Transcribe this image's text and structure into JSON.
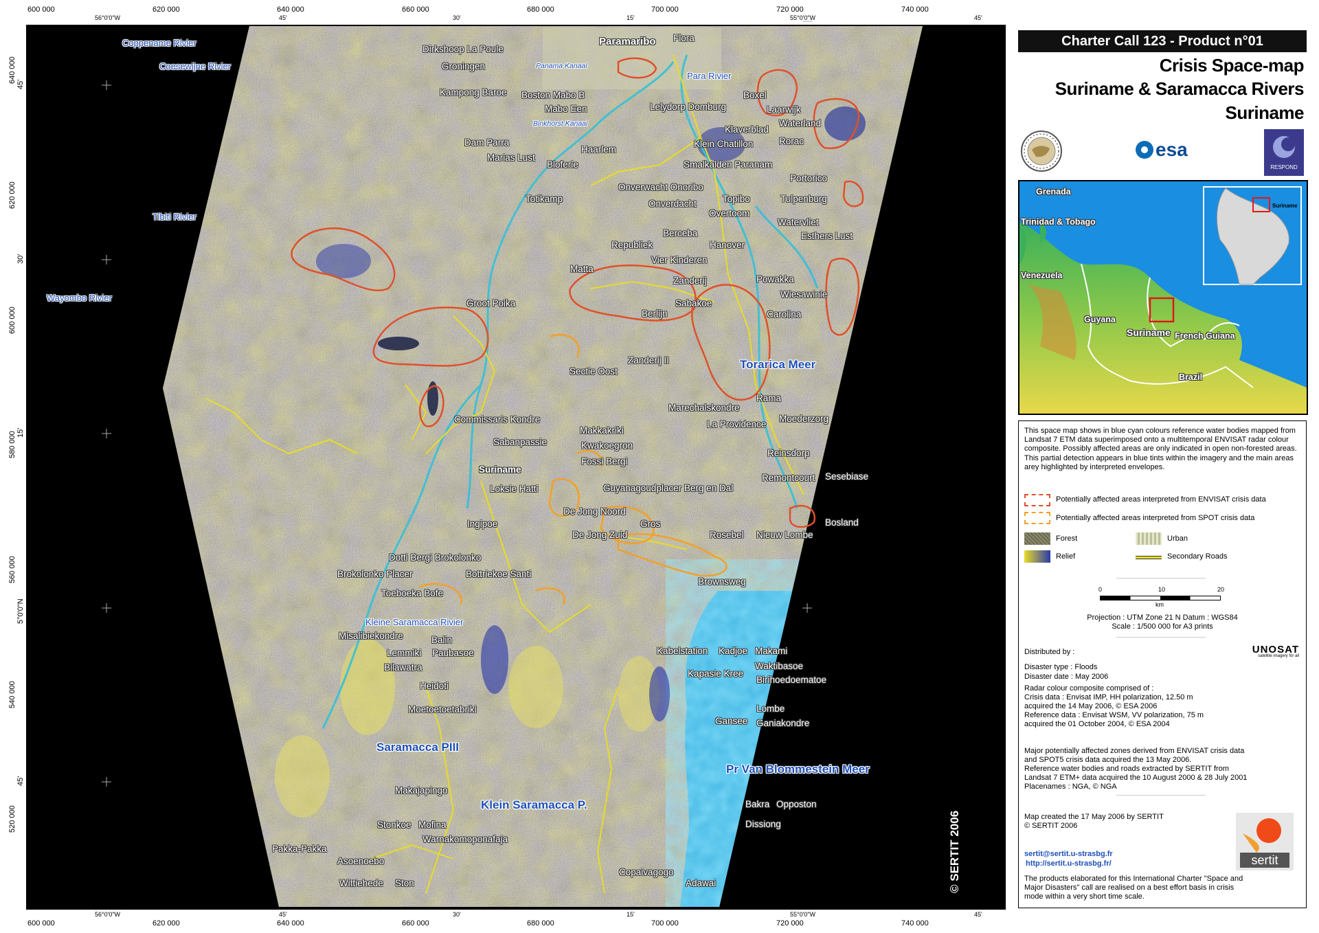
{
  "header": {
    "product_bar": "Charter Call 123 - Product n°01",
    "title_line1": "Crisis Space-map",
    "title_line2": "Suriname & Saramacca Rivers",
    "title_line3": "Suriname"
  },
  "logos": {
    "esa": "esa",
    "respond": "RESPOND",
    "unosat": "UNOSAT",
    "unosat_sub": "satellite imagery for all",
    "sertit": "sertit"
  },
  "grid": {
    "top_x_labels": [
      "600 000",
      "620 000",
      "640 000",
      "660 000",
      "680 000",
      "700 000",
      "720 000",
      "740 000"
    ],
    "bottom_x_labels": [
      "600 000",
      "620 000",
      "640 000",
      "660 000",
      "680 000",
      "700 000",
      "720 000",
      "740 000"
    ],
    "top_deg_labels": [
      "56°0'0\"W",
      "45'",
      "30'",
      "15'",
      "55°0'0\"W",
      "45'"
    ],
    "bottom_deg_labels": [
      "56°0'0\"W",
      "45'",
      "30'",
      "15'",
      "55°0'0\"W",
      "45'"
    ],
    "left_y_labels": [
      "640 000",
      "620 000",
      "600 000",
      "580 000",
      "560 000",
      "540 000",
      "520 000"
    ],
    "left_deg_labels": [
      "45'",
      "30'",
      "15'",
      "5°0'0\"N",
      "45'"
    ],
    "right_y_labels": [
      "640 000",
      "620 000",
      "600 000",
      "580 000",
      "560 000",
      "540 000",
      "520 000"
    ],
    "right_deg_labels": [
      "45'",
      "30'",
      "15'",
      "5°0'0\"N",
      "45'"
    ]
  },
  "rivers": [
    {
      "name": "Coppename Rivier"
    },
    {
      "name": "Coesewijne Rivier"
    },
    {
      "name": "Tibiti Rivier"
    },
    {
      "name": "Wayombo Rivier"
    },
    {
      "name": "Para Rivier"
    },
    {
      "name": "Panama Kanaal"
    },
    {
      "name": "Binkhorst Kanaal"
    },
    {
      "name": "Torarica Meer"
    },
    {
      "name": "Kleine Saramacca Rivier"
    },
    {
      "name": "Saramacca PIII"
    },
    {
      "name": "Klein Saramacca P."
    },
    {
      "name": "Pr Van Blommestein Meer"
    }
  ],
  "places": [
    "Paramaribo",
    "Flora",
    "Dirkshoop La Poule",
    "Groningen",
    "Kampong Baroe",
    "Boston Mabo B",
    "Mabo Een",
    "Lelydorp Domburg",
    "Boxel",
    "Laarwijk",
    "Waterland",
    "Dam Parra",
    "Marias Lust",
    "Haarlem",
    "Bloferie",
    "Klaverblad",
    "Klein Chatillon",
    "Rorac",
    "Smalkalden Paranam",
    "Portorico",
    "Onverwacht Onoribo",
    "Topibo",
    "Tulpenburg",
    "Totikamp",
    "Onverdacht",
    "Overtoom",
    "Watervliet",
    "Berceba",
    "Esthers Lust",
    "Republiek",
    "Hanover",
    "Vier Kinderen",
    "Matta",
    "Zanderij",
    "Powakka",
    "Groot Poika",
    "Sabakoe",
    "Wiesawinie",
    "Berlijn",
    "Carolina",
    "Zanderij II",
    "Sectie Oost",
    "Rama",
    "Marechalskondre",
    "Commissaris Kondre",
    "Moederzorg",
    "Makkakriki",
    "La Providence",
    "Kwakoegron",
    "Sabanpassie",
    "Fossi Bergi",
    "Reinsdorp",
    "Suriname",
    "Remontcourt",
    "Sesebiase",
    "Loksie Hatti",
    "Guyanagoudplacer Berg en Dal",
    "De Jong Noord",
    "Bosland",
    "Ingipoe",
    "Gros",
    "De Jong Zuid",
    "Rosebel",
    "Nieuw Lombe",
    "Dotti Bergi Brokolonko",
    "Brokolonko Placer",
    "Bottriekoe Santi",
    "Brownsweg",
    "Toeboeka Bofe",
    "Misalibiekondre",
    "Balin",
    "Lemmiki",
    "Paubasoe",
    "Kabelstation",
    "Kadjoe",
    "Makami",
    "Bilawatra",
    "Waktibasoe",
    "Kapasie Kree",
    "Birihoedoematoe",
    "Heidoti",
    "Moetoetoetabriki",
    "Lombe",
    "Gansee",
    "Ganiakondre",
    "Makajapingo",
    "Bakra",
    "Opposton",
    "Dissiong",
    "Stonkoe",
    "Mofina",
    "Warnakomoponafaja",
    "Pakka-Pakka",
    "Asoenoebo",
    "Copaivagogo",
    "Wittiehede",
    "Ston",
    "Adawai"
  ],
  "map_copyright": "© SERTIT 2006",
  "inset": {
    "labels": [
      "Grenada",
      "Trinidad & Tobago",
      "Venezuela",
      "Guyana",
      "Suriname",
      "French Guiana",
      "Brazil"
    ],
    "mini_label": "Suriname"
  },
  "panel": {
    "description": "This space map shows in blue cyan colours reference water bodies mapped from Landsat 7 ETM data superimposed onto a multitemporal ENVISAT radar colour composite. Possibly affected areas are only indicated in open non-forested areas. This partial detection appears in blue tints within the imagery and the main areas arey highlighted by interpreted envelopes.",
    "legend": {
      "envisat": "Potentially affected areas interpreted from ENVISAT crisis data",
      "spot": "Potentially affected areas interpreted from SPOT crisis data",
      "forest": "Forest",
      "urban": "Urban",
      "relief": "Relief",
      "roads": "Secondary Roads",
      "envisat_color": "#e0502a",
      "spot_color": "#f2a02a"
    },
    "scale": {
      "ticks": [
        "0",
        "10",
        "20"
      ],
      "unit": "km"
    },
    "projection": "Projection :  UTM Zone 21 N Datum : WGS84",
    "scale_text": "Scale : 1/500 000 for A3 prints",
    "distributed_by": "Distributed by :",
    "disaster_type": "Disaster type : Floods",
    "disaster_date": "Disaster date : May 2006",
    "radar_lines": [
      "Radar colour composite comprised of :",
      "Crisis data : Envisat IMP, HH polarization, 12.50 m",
      "acquired the 14 May 2006, © ESA 2006",
      "Reference data : Envisat WSM, VV polarization, 75 m",
      "acquired the 01 October 2004, © ESA 2004"
    ],
    "zones_lines": [
      "Major potentially affected zones derived from ENVISAT crisis data",
      "and SPOT5 crisis data acquired the 13 May 2006.",
      "Reference water bodies and roads extracted by SERTIT from",
      "Landsat 7 ETM+ data acquired the 10 August 2000 & 28 July 2001",
      "Placenames : NGA, © NGA"
    ],
    "created_lines": [
      "Map created the 17 May 2006 by SERTIT",
      "© SERTIT 2006"
    ],
    "email": "sertit@sertit.u-strasbg.fr",
    "website": "http://sertit.u-strasbg.fr/",
    "footer_lines": [
      "The products elaborated for this International Charter \"Space and",
      "Major Disasters\" call are realised on a best effort basis in crisis",
      "mode within a very short time scale."
    ]
  }
}
